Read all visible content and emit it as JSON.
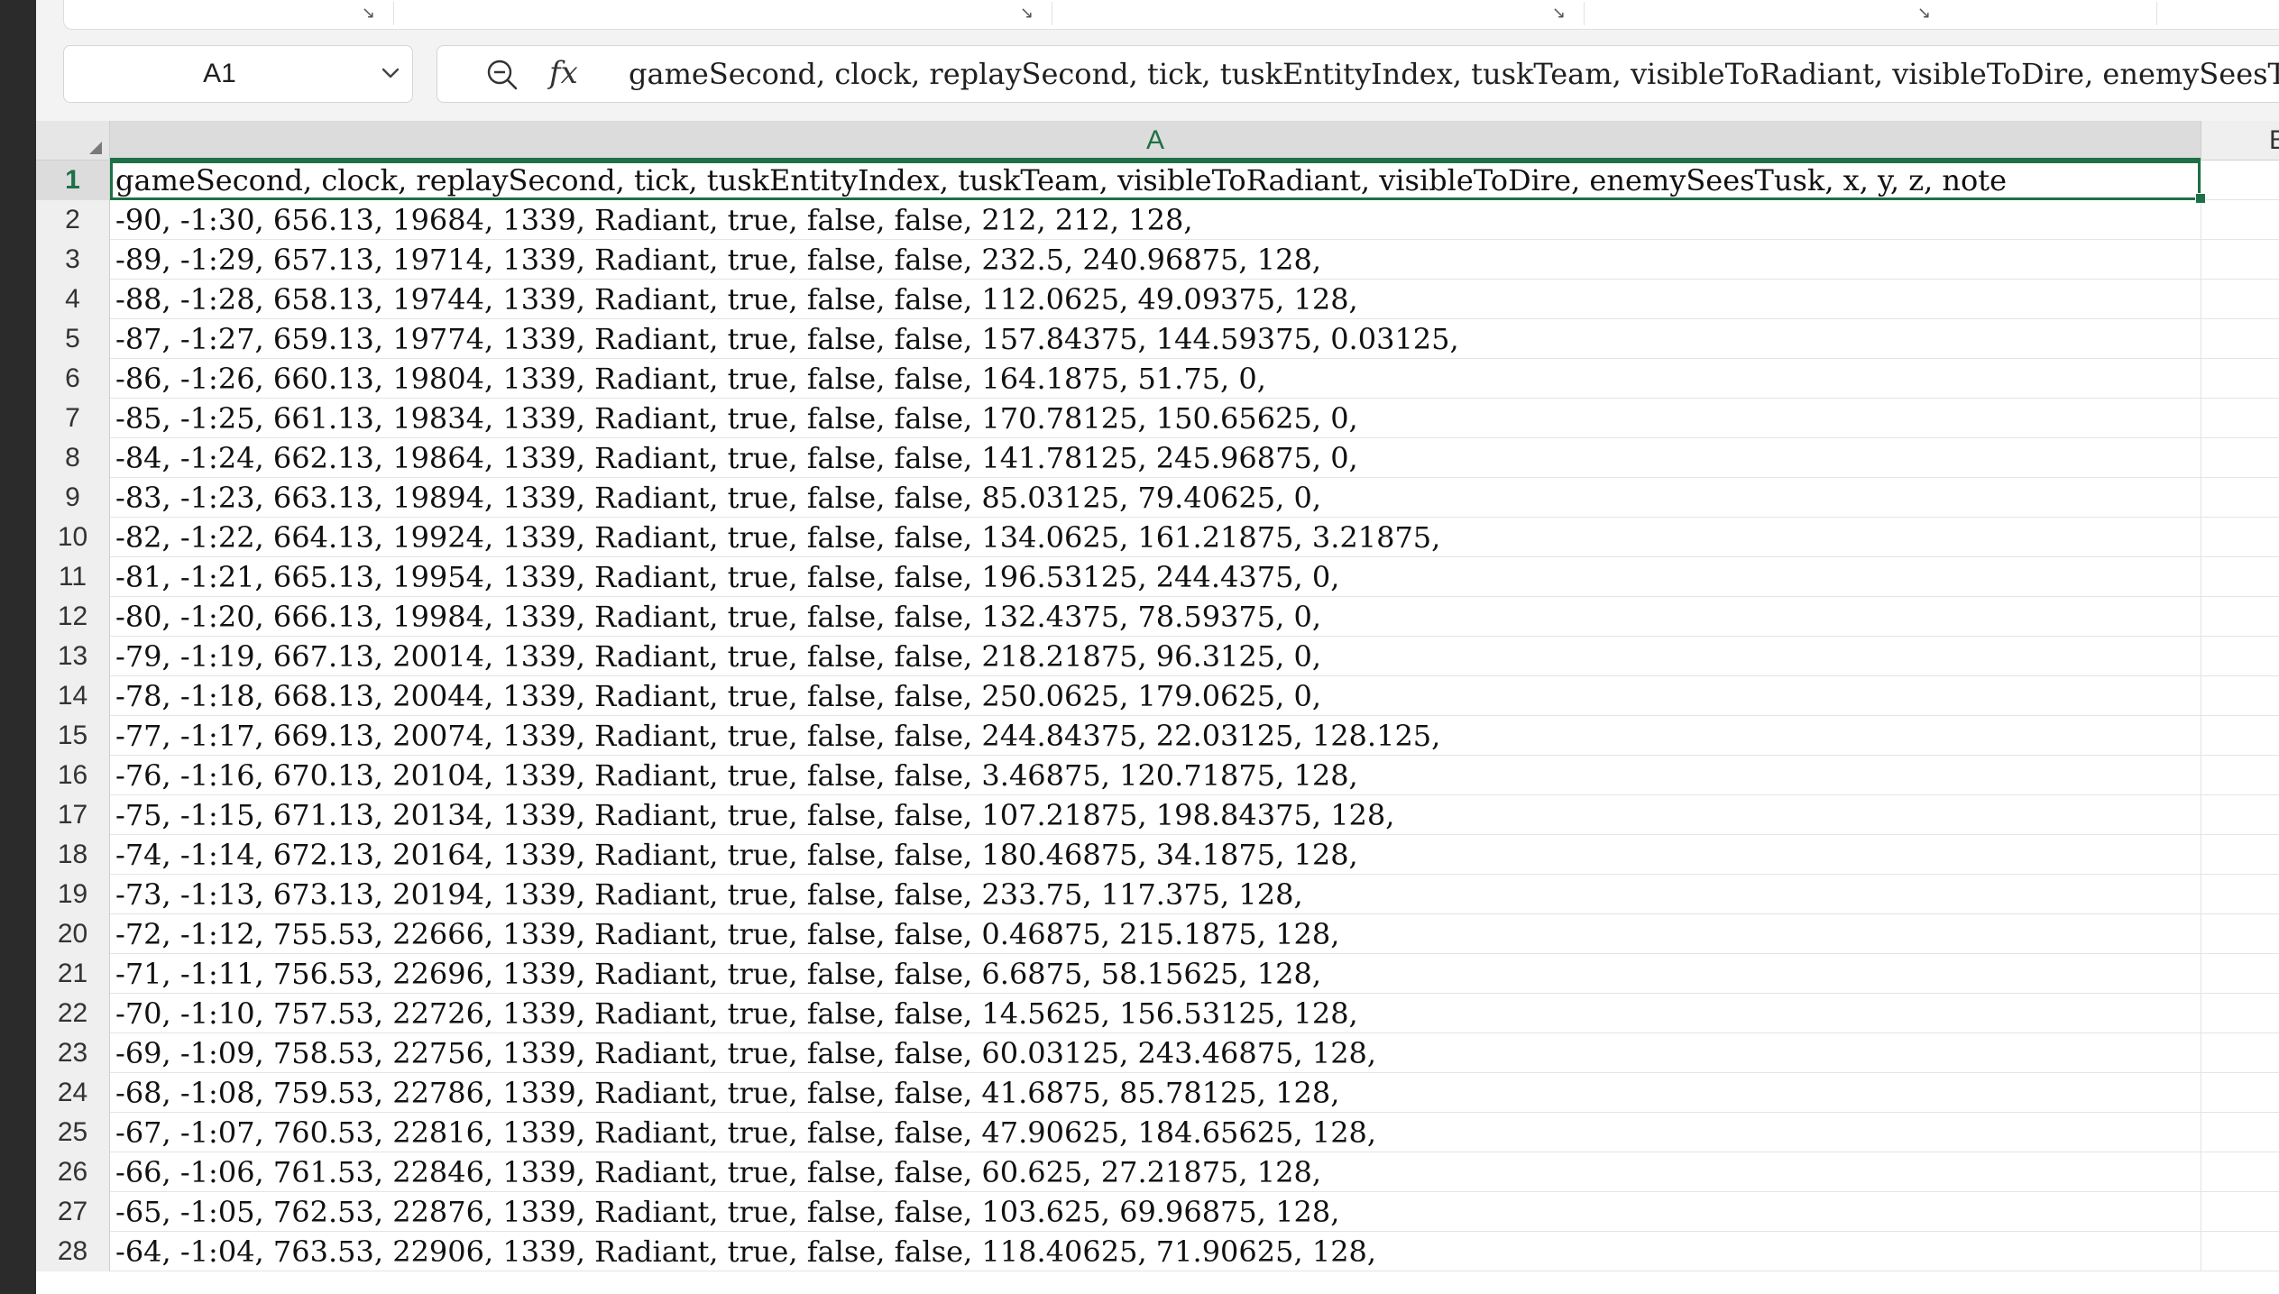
{
  "name_box": {
    "value": "A1"
  },
  "formula_bar": {
    "content": "gameSecond, clock, replaySecond, tick, tuskEntityIndex, tuskTeam, visibleToRadiant, visibleToDire, enemySeesTusk, x, y, z, note"
  },
  "columns": [
    "A",
    "B"
  ],
  "rows": [
    {
      "n": "1",
      "a": "gameSecond, clock, replaySecond, tick, tuskEntityIndex, tuskTeam, visibleToRadiant, visibleToDire, enemySeesTusk, x, y, z, note"
    },
    {
      "n": "2",
      "a": "-90, -1:30, 656.13, 19684, 1339, Radiant, true, false, false, 212, 212, 128,"
    },
    {
      "n": "3",
      "a": "-89, -1:29, 657.13, 19714, 1339, Radiant, true, false, false, 232.5, 240.96875, 128,"
    },
    {
      "n": "4",
      "a": "-88, -1:28, 658.13, 19744, 1339, Radiant, true, false, false, 112.0625, 49.09375, 128,"
    },
    {
      "n": "5",
      "a": "-87, -1:27, 659.13, 19774, 1339, Radiant, true, false, false, 157.84375, 144.59375, 0.03125,"
    },
    {
      "n": "6",
      "a": "-86, -1:26, 660.13, 19804, 1339, Radiant, true, false, false, 164.1875, 51.75, 0,"
    },
    {
      "n": "7",
      "a": "-85, -1:25, 661.13, 19834, 1339, Radiant, true, false, false, 170.78125, 150.65625, 0,"
    },
    {
      "n": "8",
      "a": "-84, -1:24, 662.13, 19864, 1339, Radiant, true, false, false, 141.78125, 245.96875, 0,"
    },
    {
      "n": "9",
      "a": "-83, -1:23, 663.13, 19894, 1339, Radiant, true, false, false, 85.03125, 79.40625, 0,"
    },
    {
      "n": "10",
      "a": "-82, -1:22, 664.13, 19924, 1339, Radiant, true, false, false, 134.0625, 161.21875, 3.21875,"
    },
    {
      "n": "11",
      "a": "-81, -1:21, 665.13, 19954, 1339, Radiant, true, false, false, 196.53125, 244.4375, 0,"
    },
    {
      "n": "12",
      "a": "-80, -1:20, 666.13, 19984, 1339, Radiant, true, false, false, 132.4375, 78.59375, 0,"
    },
    {
      "n": "13",
      "a": "-79, -1:19, 667.13, 20014, 1339, Radiant, true, false, false, 218.21875, 96.3125, 0,"
    },
    {
      "n": "14",
      "a": "-78, -1:18, 668.13, 20044, 1339, Radiant, true, false, false, 250.0625, 179.0625, 0,"
    },
    {
      "n": "15",
      "a": "-77, -1:17, 669.13, 20074, 1339, Radiant, true, false, false, 244.84375, 22.03125, 128.125,"
    },
    {
      "n": "16",
      "a": "-76, -1:16, 670.13, 20104, 1339, Radiant, true, false, false, 3.46875, 120.71875, 128,"
    },
    {
      "n": "17",
      "a": "-75, -1:15, 671.13, 20134, 1339, Radiant, true, false, false, 107.21875, 198.84375, 128,"
    },
    {
      "n": "18",
      "a": "-74, -1:14, 672.13, 20164, 1339, Radiant, true, false, false, 180.46875, 34.1875, 128,"
    },
    {
      "n": "19",
      "a": "-73, -1:13, 673.13, 20194, 1339, Radiant, true, false, false, 233.75, 117.375, 128,"
    },
    {
      "n": "20",
      "a": "-72, -1:12, 755.53, 22666, 1339, Radiant, true, false, false, 0.46875, 215.1875, 128,"
    },
    {
      "n": "21",
      "a": "-71, -1:11, 756.53, 22696, 1339, Radiant, true, false, false, 6.6875, 58.15625, 128,"
    },
    {
      "n": "22",
      "a": "-70, -1:10, 757.53, 22726, 1339, Radiant, true, false, false, 14.5625, 156.53125, 128,"
    },
    {
      "n": "23",
      "a": "-69, -1:09, 758.53, 22756, 1339, Radiant, true, false, false, 60.03125, 243.46875, 128,"
    },
    {
      "n": "24",
      "a": "-68, -1:08, 759.53, 22786, 1339, Radiant, true, false, false, 41.6875, 85.78125, 128,"
    },
    {
      "n": "25",
      "a": "-67, -1:07, 760.53, 22816, 1339, Radiant, true, false, false, 47.90625, 184.65625, 128,"
    },
    {
      "n": "26",
      "a": "-66, -1:06, 761.53, 22846, 1339, Radiant, true, false, false, 60.625, 27.21875, 128,"
    },
    {
      "n": "27",
      "a": "-65, -1:05, 762.53, 22876, 1339, Radiant, true, false, false, 103.625, 69.96875, 128,"
    },
    {
      "n": "28",
      "a": "-64, -1:04, 763.53, 22906, 1339, Radiant, true, false, false, 118.40625, 71.90625, 128,"
    }
  ],
  "colors": {
    "accent": "#1e7145",
    "header_bg": "#efefef",
    "grid": "#e4e4e4"
  },
  "icons": {
    "zoom": "zoom-out-icon",
    "function": "fx-icon",
    "dropdown": "chevron-down-icon",
    "launcher": "dialog-launcher-icon"
  }
}
